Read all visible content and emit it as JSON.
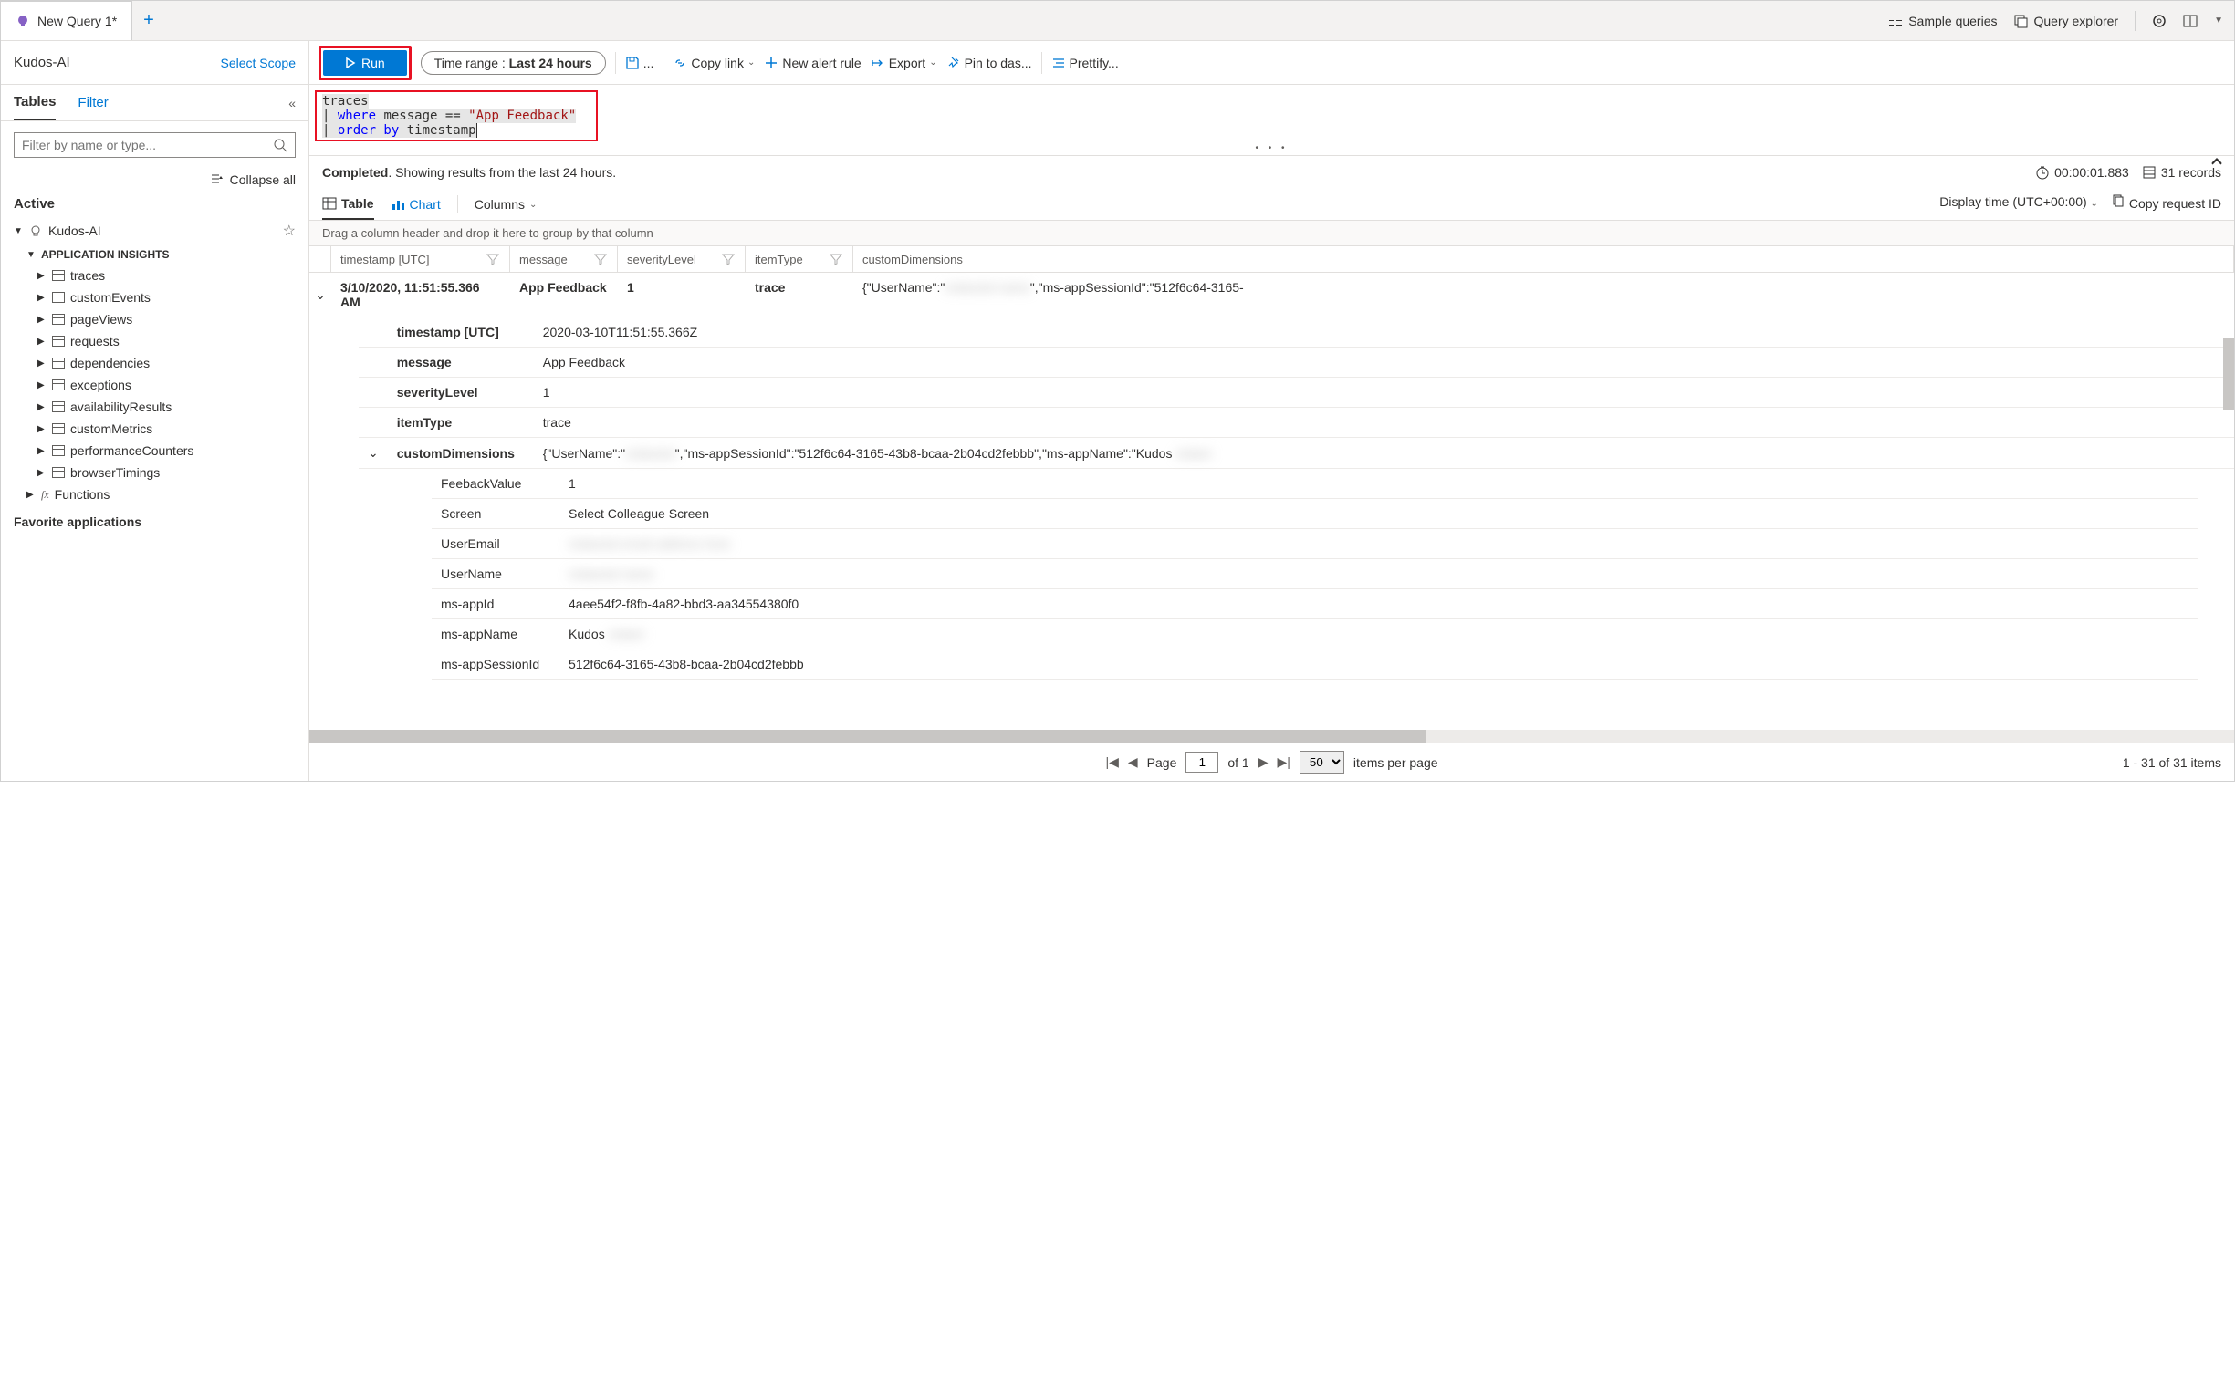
{
  "top": {
    "tab_title": "New Query 1*",
    "sample_queries": "Sample queries",
    "query_explorer": "Query explorer"
  },
  "scope": {
    "name": "Kudos-AI",
    "select": "Select Scope"
  },
  "toolbar": {
    "run": "Run",
    "time_label": "Time range : ",
    "time_value": "Last 24 hours",
    "save_more": "...",
    "copy_link": "Copy link",
    "new_alert": "New alert rule",
    "export": "Export",
    "pin": "Pin to das...",
    "prettify": "Prettify..."
  },
  "query": {
    "line1": "traces",
    "line2_kw": "where",
    "line2_field": " message == ",
    "line2_str": "\"App Feedback\"",
    "line3_kw": "order by",
    "line3_field": " timestamp"
  },
  "sidebar": {
    "tab_tables": "Tables",
    "tab_filter": "Filter",
    "search_placeholder": "Filter by name or type...",
    "collapse_all": "Collapse all",
    "section_active": "Active",
    "root": "Kudos-AI",
    "category": "APPLICATION INSIGHTS",
    "leaves": [
      "traces",
      "customEvents",
      "pageViews",
      "requests",
      "dependencies",
      "exceptions",
      "availabilityResults",
      "customMetrics",
      "performanceCounters",
      "browserTimings"
    ],
    "functions": "Functions",
    "fav": "Favorite applications"
  },
  "results": {
    "completed": "Completed",
    "summary": ". Showing results from the last 24 hours.",
    "duration": "00:00:01.883",
    "records": "31 records",
    "tab_table": "Table",
    "tab_chart": "Chart",
    "columns": "Columns",
    "display_time": "Display time (UTC+00:00)",
    "copy_request": "Copy request ID",
    "group_hint": "Drag a column header and drop it here to group by that column",
    "cols": {
      "ts": "timestamp [UTC]",
      "msg": "message",
      "sev": "severityLevel",
      "it": "itemType",
      "cd": "customDimensions"
    },
    "row": {
      "ts": "3/10/2020, 11:51:55.366 AM",
      "msg": "App Feedback",
      "sev": "1",
      "it": "trace",
      "cd_prefix": "{\"UserName\":\"",
      "cd_suffix": "\",\"ms-appSessionId\":\"512f6c64-3165-"
    },
    "detail": {
      "ts_k": "timestamp [UTC]",
      "ts_v": "2020-03-10T11:51:55.366Z",
      "msg_k": "message",
      "msg_v": "App Feedback",
      "sev_k": "severityLevel",
      "sev_v": "1",
      "it_k": "itemType",
      "it_v": "trace",
      "cd_k": "customDimensions",
      "cd_v_prefix": "{\"UserName\":\"",
      "cd_v_mid": "\",\"ms-appSessionId\":\"512f6c64-3165-43b8-bcaa-2b04cd2febbb\",\"ms-appName\":\"Kudos"
    },
    "nested": {
      "feedback_k": "FeebackValue",
      "feedback_v": "1",
      "screen_k": "Screen",
      "screen_v": "Select Colleague Screen",
      "email_k": "UserEmail",
      "name_k": "UserName",
      "appid_k": "ms-appId",
      "appid_v": "4aee54f2-f8fb-4a82-bbd3-aa34554380f0",
      "appname_k": "ms-appName",
      "appname_v_prefix": "Kudos",
      "sess_k": "ms-appSessionId",
      "sess_v": "512f6c64-3165-43b8-bcaa-2b04cd2febbb"
    }
  },
  "pager": {
    "page_label": "Page",
    "of": "of 1",
    "page_val": "1",
    "size": "50",
    "ipp": "items per page",
    "range": "1 - 31 of 31 items"
  }
}
